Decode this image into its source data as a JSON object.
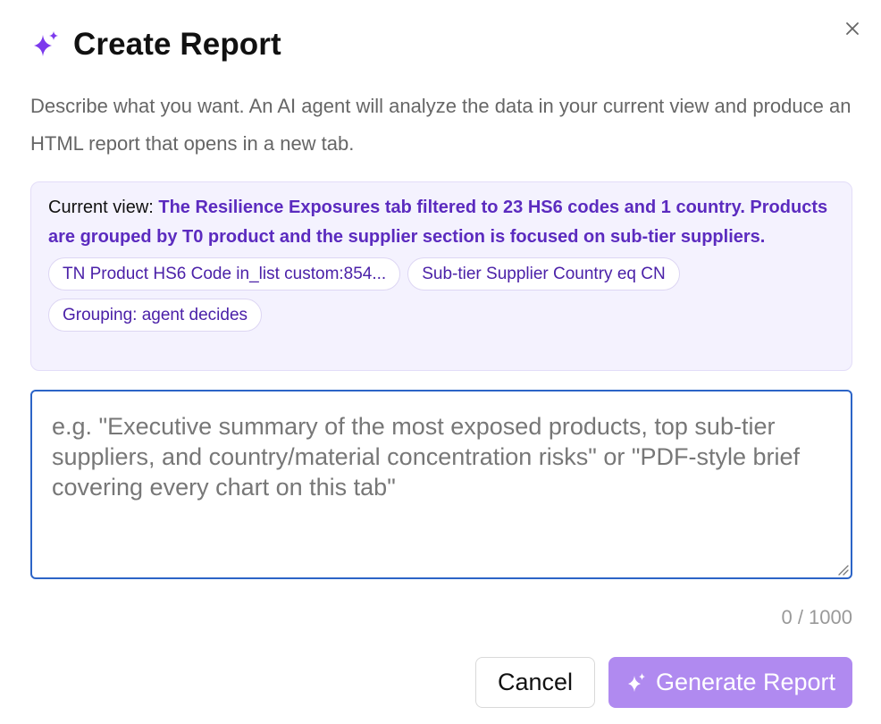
{
  "dialog": {
    "title": "Create Report",
    "icon": "sparkle-icon",
    "close_icon": "close-icon",
    "description": "Describe what you want. An AI agent will analyze the data in your current view and produce an HTML report that opens in a new tab."
  },
  "context": {
    "label": "Current view:",
    "description": "The Resilience Exposures tab filtered to 23 HS6 codes and 1 country. Products are grouped by T0 product and the supplier section is focused on sub-tier suppliers.",
    "chips": [
      "TN Product HS6 Code in_list custom:854...",
      "Sub-tier Supplier Country eq CN",
      "Grouping: agent decides"
    ]
  },
  "prompt": {
    "value": "",
    "placeholder": "e.g. \"Executive summary of the most exposed products, top sub-tier suppliers, and country/material concentration risks\" or \"PDF-style brief covering every chart on this tab\"",
    "char_count": "0 / 1000"
  },
  "actions": {
    "cancel_label": "Cancel",
    "generate_label": "Generate Report",
    "generate_icon": "sparkle-icon"
  },
  "colors": {
    "accent": "#7c3aed",
    "context_text": "#5b2bbf",
    "context_bg": "#f4f2fe",
    "input_border": "#2c64c7",
    "generate_button_bg": "#b08af0"
  }
}
